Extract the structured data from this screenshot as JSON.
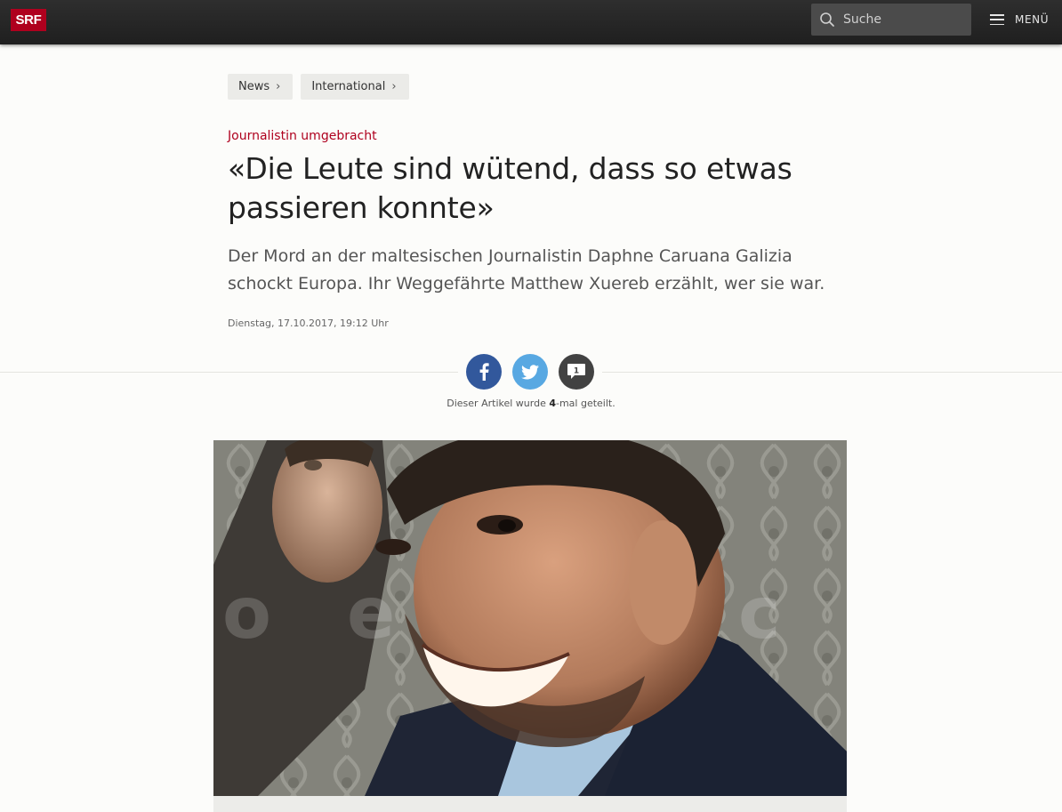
{
  "header": {
    "logo": "SRF",
    "search_placeholder": "Suche",
    "menu_label": "MENÜ"
  },
  "breadcrumbs": [
    {
      "label": "News"
    },
    {
      "label": "International"
    }
  ],
  "article": {
    "kicker": "Journalistin umgebracht",
    "headline": "«Die Leute sind wütend, dass so etwas passieren konnte»",
    "lead": "Der Mord an der maltesischen Journalistin Daphne Caruana Galizia schockt Europa. Ihr Weggefährte Matthew Xuereb erzählt, wer sie war.",
    "date": "Dienstag, 17.10.2017, 19:12 Uhr"
  },
  "share": {
    "comment_count": "1",
    "note_prefix": "Dieser Artikel wurde ",
    "note_count": "4",
    "note_suffix": "-mal geteilt."
  },
  "colors": {
    "brand_red": "#af001e",
    "facebook": "#32589c",
    "twitter": "#58a8e2"
  },
  "icons": {
    "search": "search-icon",
    "menu": "hamburger-icon",
    "facebook": "facebook-icon",
    "twitter": "twitter-icon",
    "comment": "comment-bubble-icon"
  }
}
